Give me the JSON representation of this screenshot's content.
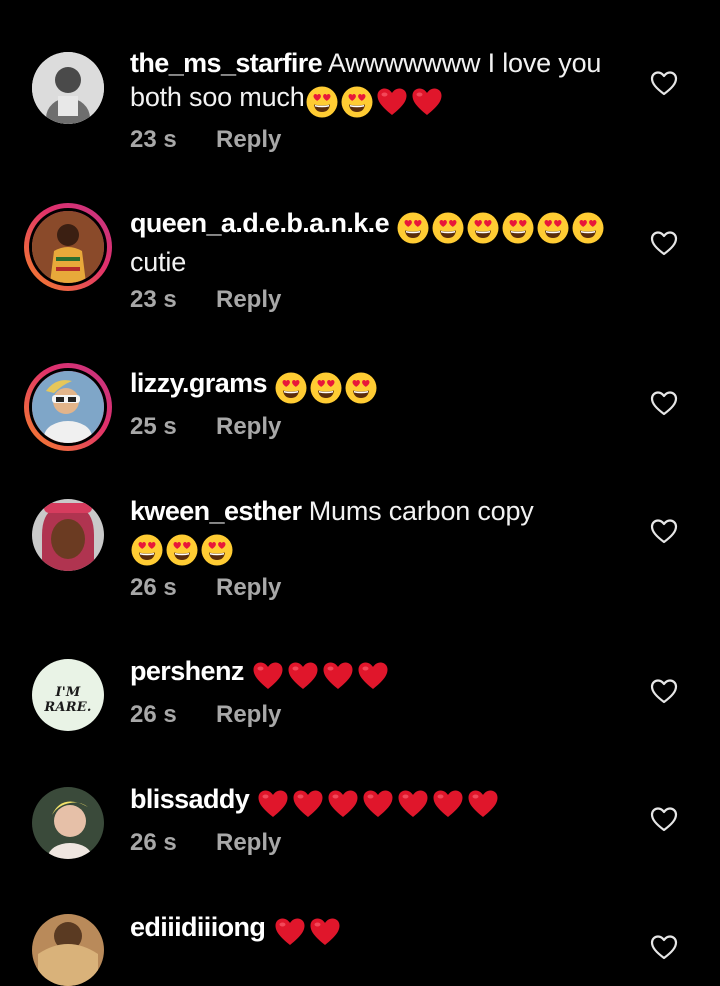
{
  "comments": [
    {
      "username": "the_ms_starfire",
      "text": "Awwwwwww I love you both soo much",
      "emojis": [
        "heart-eyes",
        "heart-eyes",
        "red-heart",
        "red-heart"
      ],
      "time": "23 s",
      "reply": "Reply"
    },
    {
      "username": "queen_a.d.e.b.a.n.k.e",
      "text": "cutie",
      "emojis": [
        "heart-eyes",
        "heart-eyes",
        "heart-eyes",
        "heart-eyes",
        "heart-eyes",
        "heart-eyes"
      ],
      "time": "23 s",
      "reply": "Reply"
    },
    {
      "username": "lizzy.grams",
      "text": "",
      "emojis": [
        "heart-eyes",
        "heart-eyes",
        "heart-eyes"
      ],
      "time": "25 s",
      "reply": "Reply"
    },
    {
      "username": "kween_esther",
      "text": "Mums carbon copy",
      "emojis": [
        "heart-eyes",
        "heart-eyes",
        "heart-eyes"
      ],
      "time": "26 s",
      "reply": "Reply"
    },
    {
      "username": "pershenz",
      "text": "",
      "avatar_text": "I'M RARE.",
      "emojis": [
        "red-heart",
        "red-heart",
        "red-heart",
        "red-heart"
      ],
      "time": "26 s",
      "reply": "Reply"
    },
    {
      "username": "blissaddy",
      "text": "",
      "emojis": [
        "red-heart",
        "red-heart",
        "red-heart",
        "red-heart",
        "red-heart",
        "red-heart",
        "red-heart"
      ],
      "time": "26 s",
      "reply": "Reply"
    },
    {
      "username": "ediiidiiiong",
      "text": "",
      "emojis": [
        "red-heart",
        "red-heart"
      ]
    }
  ],
  "colors": {
    "background": "#000000",
    "username": "#ffffff",
    "meta": "#a8a8a8",
    "heart": "#e0162b",
    "story_ring": "#e1306c"
  }
}
